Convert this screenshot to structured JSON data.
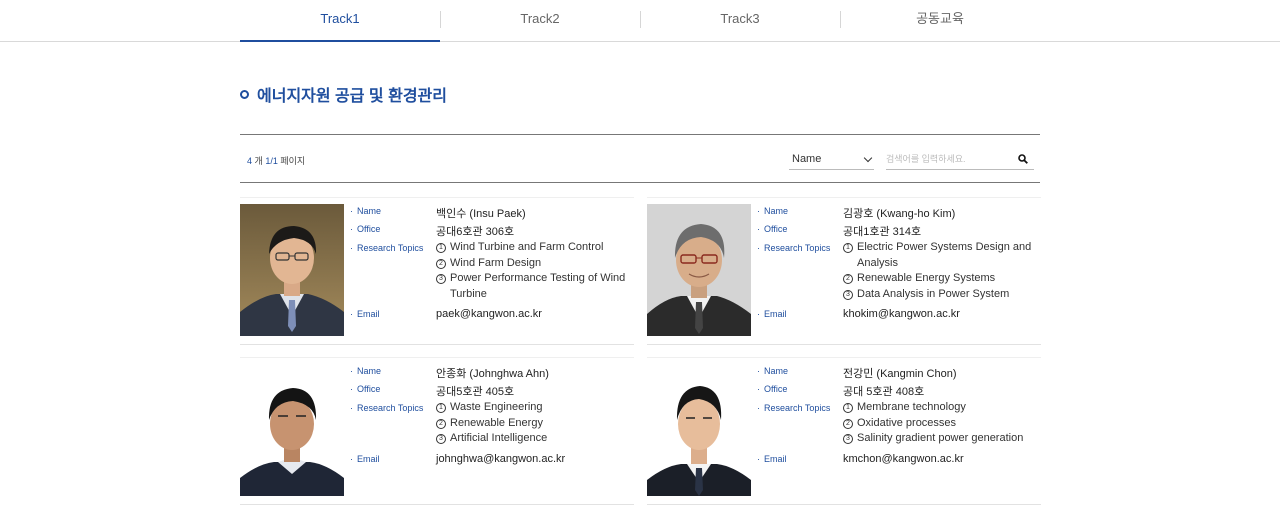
{
  "tabs": [
    {
      "label": "Track1",
      "active": true
    },
    {
      "label": "Track2",
      "active": false
    },
    {
      "label": "Track3",
      "active": false
    },
    {
      "label": "공동교육",
      "active": false
    }
  ],
  "section_title": "에너지자원 공급 및 환경관리",
  "toolbar": {
    "count_num": "4",
    "count_unit": "개",
    "page_cur": "1/1",
    "page_unit": "페이지",
    "select_value": "Name",
    "search_placeholder": "검색어를 입력하세요."
  },
  "field_labels": {
    "name": "Name",
    "office": "Office",
    "topics": "Research Topics",
    "email": "Email"
  },
  "people": [
    {
      "name": "백인수 (Insu Paek)",
      "office": "공대6호관 306호",
      "topics": [
        "Wind Turbine and Farm Control",
        "Wind Farm Design",
        "Power Performance Testing of Wind Turbine"
      ],
      "email": "paek@kangwon.ac.kr"
    },
    {
      "name": "김광호 (Kwang-ho Kim)",
      "office": "공대1호관 314호",
      "topics": [
        "Electric Power Systems Design and Analysis",
        "Renewable Energy Systems",
        "Data Analysis in Power System"
      ],
      "email": "khokim@kangwon.ac.kr"
    },
    {
      "name": "안종화 (Johnghwa Ahn)",
      "office": "공대5호관 405호",
      "topics": [
        "Waste Engineering",
        "Renewable Energy",
        "Artificial Intelligence"
      ],
      "email": "johnghwa@kangwon.ac.kr"
    },
    {
      "name": "전강민 (Kangmin Chon)",
      "office": "공대 5호관 408호",
      "topics": [
        "Membrane technology",
        "Oxidative processes",
        "Salinity gradient power generation"
      ],
      "email": "kmchon@kangwon.ac.kr"
    }
  ],
  "colors": {
    "accent": "#1f4e9e"
  }
}
